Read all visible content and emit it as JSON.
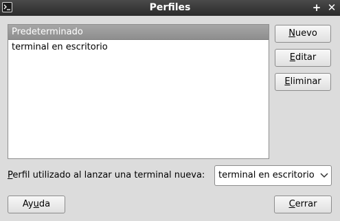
{
  "window": {
    "title": "Perfiles",
    "title_icon": "terminal-icon",
    "plus_glyph": "+",
    "close_glyph": "✕"
  },
  "profiles": {
    "items": [
      {
        "label": "Predeterminado",
        "selected": true
      },
      {
        "label": "terminal en escritorio",
        "selected": false
      }
    ]
  },
  "buttons": {
    "nuevo": {
      "mnemonic": "N",
      "rest": "uevo"
    },
    "editar": {
      "mnemonic": "E",
      "rest": "ditar"
    },
    "eliminar": {
      "mnemonic": "E",
      "rest": "liminar"
    },
    "ayuda": {
      "pre": "Ay",
      "mnemonic": "u",
      "rest": "da"
    },
    "cerrar": {
      "mnemonic": "C",
      "rest": "errar"
    }
  },
  "launch_profile": {
    "label_mnemonic": "P",
    "label_rest": "erfil utilizado al lanzar una terminal nueva:",
    "selected_value": "terminal en escritorio"
  },
  "colors": {
    "titlebar": "#2b2b2b",
    "window_bg": "#dcdcdc",
    "selection": "#999999"
  }
}
